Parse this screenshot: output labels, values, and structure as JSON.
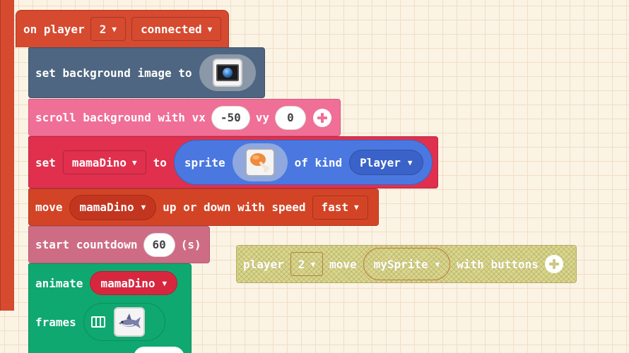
{
  "event": {
    "label_on": "on player",
    "player_value": "2",
    "state_value": "connected"
  },
  "set_bg": {
    "label": "set background image to",
    "image_icon": "screen-globe-icon"
  },
  "scroll_bg": {
    "label_main": "scroll background with vx",
    "vx": "-50",
    "label_vy": "vy",
    "vy": "0"
  },
  "set_sprite": {
    "label_set": "set",
    "variable": "mamaDino",
    "label_to": "to",
    "label_sprite": "sprite",
    "image_icon": "chicken-leg-icon",
    "label_kind": "of kind",
    "kind_value": "Player"
  },
  "move": {
    "label_move": "move",
    "variable": "mamaDino",
    "label_mid": "up or down with speed",
    "speed_value": "fast"
  },
  "countdown": {
    "label": "start countdown",
    "value": "60",
    "unit": "(s)"
  },
  "animate": {
    "label_animate": "animate",
    "variable": "mamaDino",
    "label_frames": "frames",
    "frame_icon": "shark-icon"
  },
  "ghost": {
    "label_player": "player",
    "player_value": "2",
    "label_move": "move",
    "sprite_value": "mySprite",
    "label_with": "with buttons"
  },
  "colors": {
    "event": "#d64a30",
    "scene": "#4e6681",
    "scroll": "#f06f96",
    "sprites": "#e0304e",
    "controller": "#d34426",
    "info": "#cf6c85",
    "animation": "#0fa870",
    "workspace": "#fbf3e4"
  }
}
